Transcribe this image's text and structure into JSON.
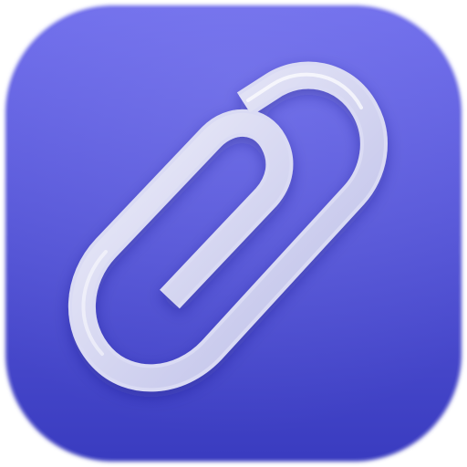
{
  "icon": {
    "name": "paperclip-icon",
    "colors": {
      "background_top": "#6E6CEB",
      "background_bottom": "#3A3CC0",
      "clip_light": "#F4F4FC",
      "clip_shadow": "#B7B9E6"
    }
  }
}
